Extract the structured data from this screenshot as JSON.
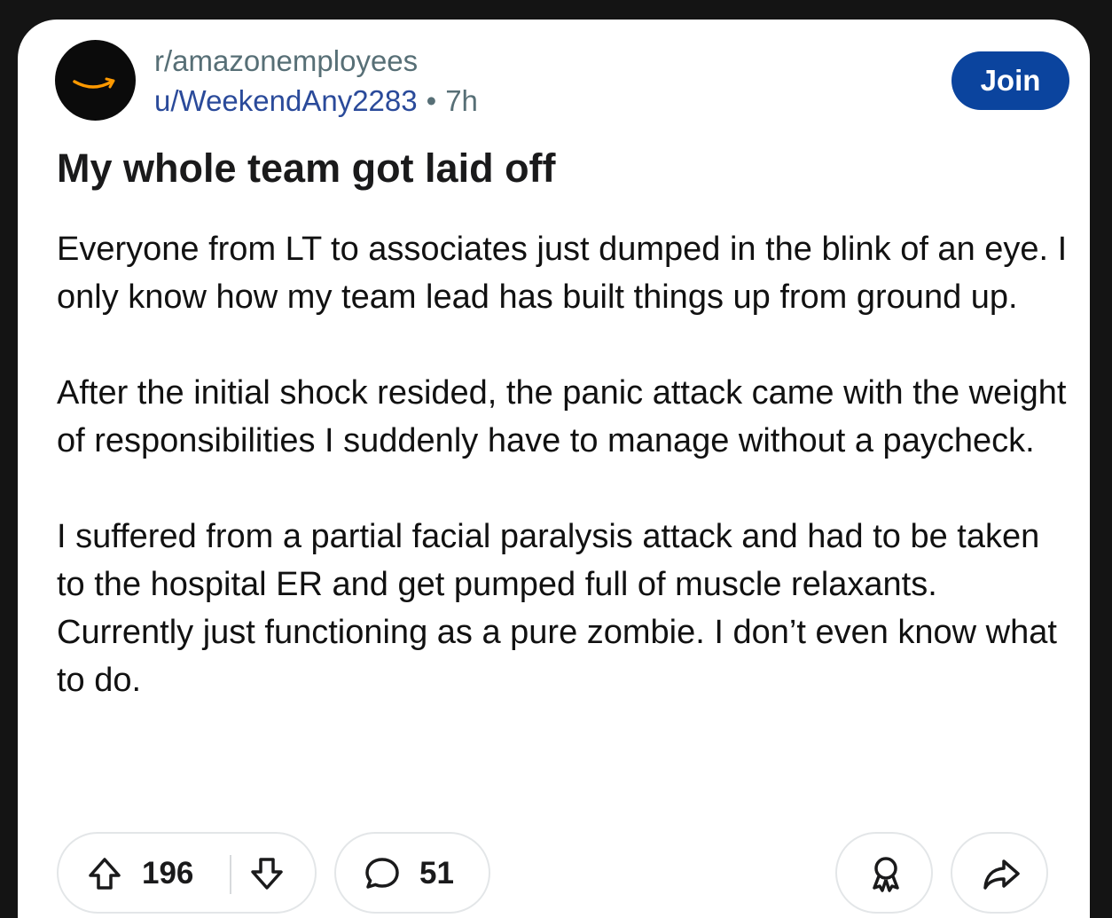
{
  "post": {
    "subreddit": "r/amazonemployees",
    "username": "u/WeekendAny2283",
    "separator": "•",
    "age": "7h",
    "join_label": "Join",
    "title": "My whole team got laid off",
    "body": [
      "Everyone from LT to associates just dumped in the blink of an eye. I only know how my team lead has built things up from ground up.",
      "After the initial shock resided, the panic attack came with the weight of responsibilities I suddenly have to manage without a paycheck.",
      "I suffered from a partial facial paralysis attack and had to be taken to the hospital ER and get pumped full of muscle relaxants. Currently just functioning as a pure zombie. I don’t even know what to do."
    ]
  },
  "actions": {
    "upvote_count": "196",
    "comment_count": "51"
  },
  "icons": {
    "avatar": "amazon-smile-logo",
    "upvote": "arrow-up-icon",
    "downvote": "arrow-down-icon",
    "comments": "speech-bubble-icon",
    "award": "award-icon",
    "share": "share-arrow-icon"
  },
  "colors": {
    "join_button": "#0b449e",
    "username": "#2a4a9a",
    "meta_text": "#576f76",
    "logo_orange": "#ff9900"
  }
}
